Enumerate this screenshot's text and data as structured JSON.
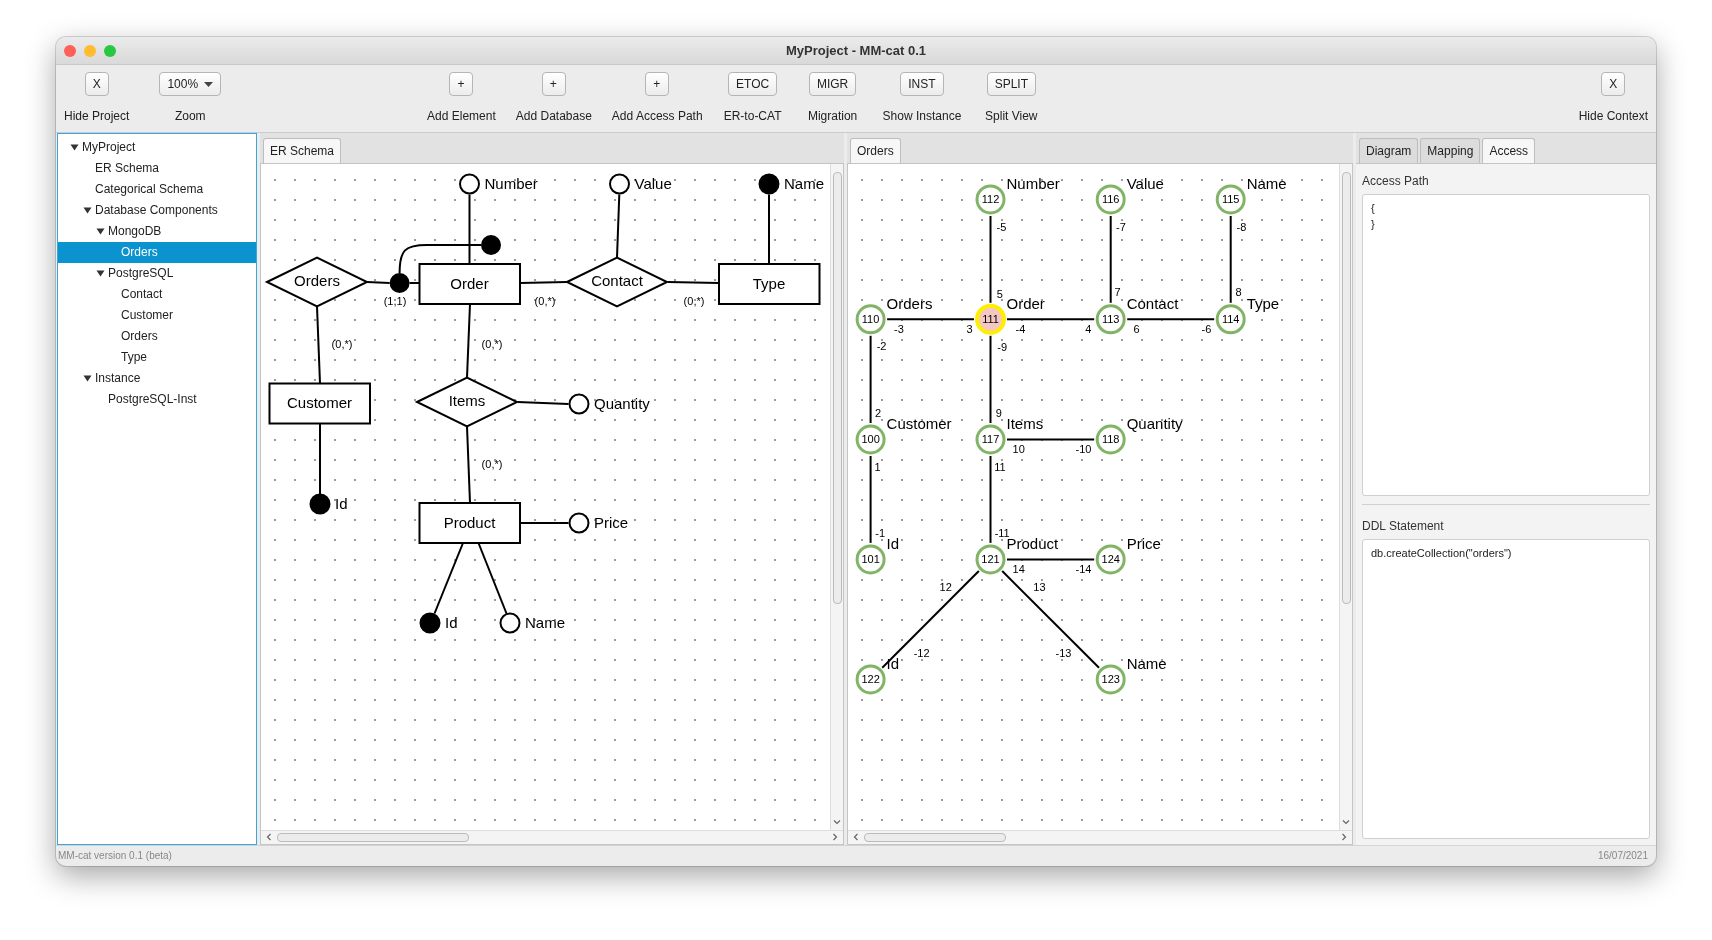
{
  "window": {
    "title": "MyProject - MM-cat 0.1"
  },
  "toolbar": {
    "left": [
      {
        "kind": "button",
        "button": "X",
        "label": "Hide Project"
      },
      {
        "kind": "dropdown",
        "button": "100%",
        "label": "Zoom"
      }
    ],
    "center": [
      {
        "kind": "button",
        "button": "+",
        "label": "Add Element"
      },
      {
        "kind": "button",
        "button": "+",
        "label": "Add Database"
      },
      {
        "kind": "button",
        "button": "+",
        "label": "Add Access Path"
      },
      {
        "kind": "button",
        "button": "ETOC",
        "label": "ER-to-CAT"
      },
      {
        "kind": "button",
        "button": "MIGR",
        "label": "Migration"
      },
      {
        "kind": "button",
        "button": "INST",
        "label": "Show Instance"
      },
      {
        "kind": "button",
        "button": "SPLIT",
        "label": "Split View"
      }
    ],
    "right": [
      {
        "kind": "button",
        "button": "X",
        "label": "Hide Context"
      }
    ]
  },
  "project_tree": [
    {
      "label": "MyProject",
      "expanded": true,
      "selected": false,
      "children": [
        {
          "label": "ER Schema",
          "selected": false
        },
        {
          "label": "Categorical Schema",
          "selected": false
        },
        {
          "label": "Database Components",
          "expanded": true,
          "selected": false,
          "children": [
            {
              "label": "MongoDB",
              "expanded": true,
              "selected": false,
              "children": [
                {
                  "label": "Orders",
                  "selected": true
                }
              ]
            },
            {
              "label": "PostgreSQL",
              "expanded": true,
              "selected": false,
              "children": [
                {
                  "label": "Contact",
                  "selected": false
                },
                {
                  "label": "Customer",
                  "selected": false
                },
                {
                  "label": "Orders",
                  "selected": false
                },
                {
                  "label": "Type",
                  "selected": false
                }
              ]
            }
          ]
        },
        {
          "label": "Instance",
          "expanded": true,
          "selected": false,
          "children": [
            {
              "label": "PostgreSQL-Inst",
              "selected": false
            }
          ]
        }
      ]
    }
  ],
  "er_pane": {
    "tabs": [
      {
        "label": "ER Schema",
        "selected": true
      }
    ],
    "entities": [
      {
        "label": "Order"
      },
      {
        "label": "Type"
      },
      {
        "label": "Customer"
      },
      {
        "label": "Product"
      }
    ],
    "relationships": [
      {
        "label": "Orders"
      },
      {
        "label": "Contact"
      },
      {
        "label": "Items"
      }
    ],
    "attributes": [
      {
        "label": "Number",
        "identifier": false
      },
      {
        "label": "Value",
        "identifier": false
      },
      {
        "label": "Name",
        "identifier": true
      },
      {
        "label": "Quantity",
        "identifier": false
      },
      {
        "label": "Id",
        "identifier": true
      },
      {
        "label": "Price",
        "identifier": false
      },
      {
        "label": "Id",
        "identifier": true
      },
      {
        "label": "Name",
        "identifier": false
      }
    ],
    "cardinalities": [
      "(1,1)",
      "(0,*)",
      "(0,*)",
      "(0,*)",
      "(0,*)",
      "(0,*)"
    ]
  },
  "category_pane": {
    "tabs": [
      {
        "label": "Orders",
        "selected": true
      }
    ],
    "nodes": [
      {
        "id": "112",
        "label": "Number",
        "selected": false
      },
      {
        "id": "116",
        "label": "Value",
        "selected": false
      },
      {
        "id": "115",
        "label": "Name",
        "selected": false
      },
      {
        "id": "110",
        "label": "Orders",
        "selected": false
      },
      {
        "id": "111",
        "label": "Order",
        "selected": true
      },
      {
        "id": "113",
        "label": "Contact",
        "selected": false
      },
      {
        "id": "114",
        "label": "Type",
        "selected": false
      },
      {
        "id": "100",
        "label": "Customer",
        "selected": false
      },
      {
        "id": "117",
        "label": "Items",
        "selected": false
      },
      {
        "id": "118",
        "label": "Quantity",
        "selected": false
      },
      {
        "id": "101",
        "label": "Id",
        "selected": false
      },
      {
        "id": "121",
        "label": "Product",
        "selected": false
      },
      {
        "id": "124",
        "label": "Price",
        "selected": false
      },
      {
        "id": "122",
        "label": "Id",
        "selected": false
      },
      {
        "id": "123",
        "label": "Name",
        "selected": false
      }
    ],
    "edges": [
      {
        "labels": [
          "-5",
          "5"
        ]
      },
      {
        "labels": [
          "-7",
          "7"
        ]
      },
      {
        "labels": [
          "-8",
          "8"
        ]
      },
      {
        "labels": [
          "-3",
          "3"
        ]
      },
      {
        "labels": [
          "-4",
          "4"
        ]
      },
      {
        "labels": [
          "6",
          "-6"
        ]
      },
      {
        "labels": [
          "-2",
          "2"
        ]
      },
      {
        "labels": [
          "-9",
          "9"
        ]
      },
      {
        "labels": [
          "10",
          "-10"
        ]
      },
      {
        "labels": [
          "1",
          "-1"
        ]
      },
      {
        "labels": [
          "11",
          "-11"
        ]
      },
      {
        "labels": [
          "14",
          "-14"
        ]
      },
      {
        "labels": [
          "12",
          "-12"
        ]
      },
      {
        "labels": [
          "13",
          "-13"
        ]
      }
    ]
  },
  "context_panel": {
    "tabs": [
      {
        "label": "Diagram",
        "selected": false
      },
      {
        "label": "Mapping",
        "selected": false
      },
      {
        "label": "Access",
        "selected": true
      }
    ],
    "access_path": {
      "label": "Access Path",
      "value": "{\n}"
    },
    "ddl": {
      "label": "DDL Statement",
      "value": "db.createCollection(\"orders\")"
    }
  },
  "status_bar": {
    "left": "MM-cat version 0.1 (beta)",
    "right": "16/07/2021"
  }
}
